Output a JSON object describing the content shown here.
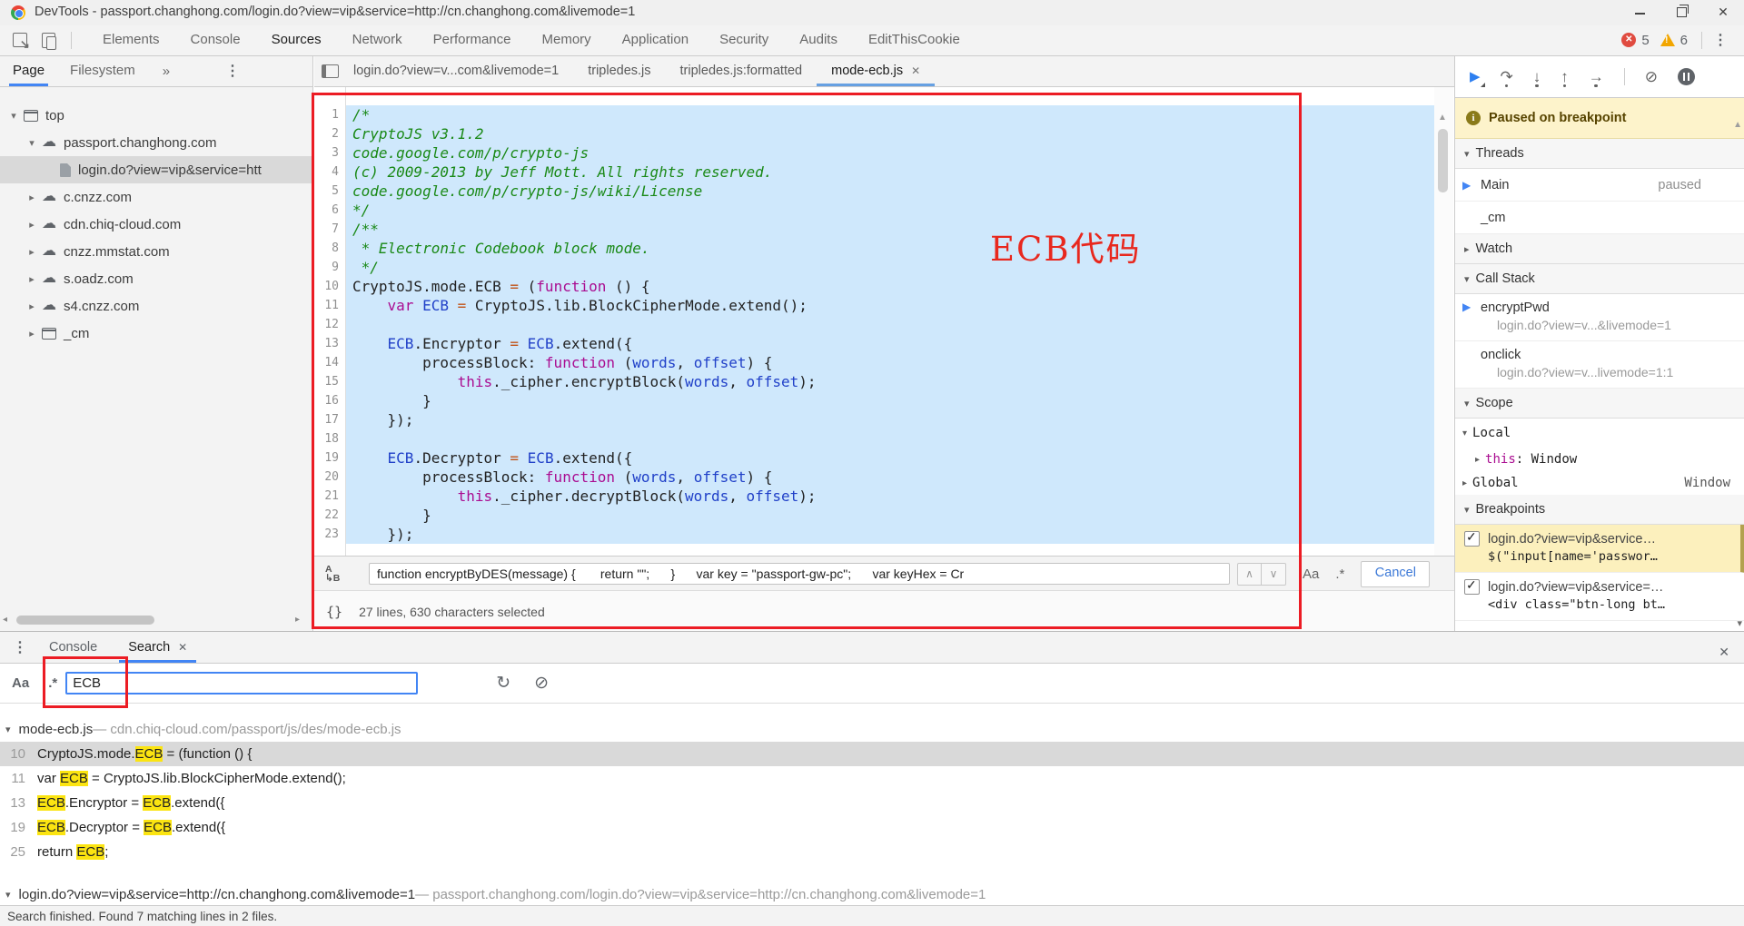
{
  "window": {
    "title": "DevTools - passport.changhong.com/login.do?view=vip&service=http://cn.changhong.com&livemode=1"
  },
  "toolbar": {
    "tabs": [
      "Elements",
      "Console",
      "Sources",
      "Network",
      "Performance",
      "Memory",
      "Application",
      "Security",
      "Audits",
      "EditThisCookie"
    ],
    "active_tab": "Sources",
    "error_count": "5",
    "warning_count": "6"
  },
  "navigator": {
    "tabs": [
      "Page",
      "Filesystem"
    ],
    "active_tab": "Page",
    "overflow_label": "»",
    "tree": [
      {
        "expander": "open",
        "icon": "frame",
        "label": "top",
        "depth": 0
      },
      {
        "expander": "open",
        "icon": "cloud",
        "label": "passport.changhong.com",
        "depth": 1
      },
      {
        "expander": "none",
        "icon": "file",
        "label": "login.do?view=vip&service=htt",
        "depth": 2,
        "selected": true
      },
      {
        "expander": "closed",
        "icon": "cloud",
        "label": "c.cnzz.com",
        "depth": 1
      },
      {
        "expander": "closed",
        "icon": "cloud",
        "label": "cdn.chiq-cloud.com",
        "depth": 1
      },
      {
        "expander": "closed",
        "icon": "cloud",
        "label": "cnzz.mmstat.com",
        "depth": 1
      },
      {
        "expander": "closed",
        "icon": "cloud",
        "label": "s.oadz.com",
        "depth": 1
      },
      {
        "expander": "closed",
        "icon": "cloud",
        "label": "s4.cnzz.com",
        "depth": 1
      },
      {
        "expander": "closed",
        "icon": "frame",
        "label": "_cm",
        "depth": 1
      }
    ]
  },
  "editor": {
    "tabs": [
      {
        "label": "login.do?view=v...com&livemode=1"
      },
      {
        "label": "tripledes.js"
      },
      {
        "label": "tripledes.js:formatted"
      },
      {
        "label": "mode-ecb.js",
        "active": true,
        "closable": true
      }
    ],
    "annotation": "ECB代码",
    "code": [
      {
        "n": "1",
        "t": [
          [
            "c",
            "/*"
          ]
        ]
      },
      {
        "n": "2",
        "t": [
          [
            "c",
            "CryptoJS v3.1.2"
          ]
        ]
      },
      {
        "n": "3",
        "t": [
          [
            "c",
            "code.google.com/p/crypto-js"
          ]
        ]
      },
      {
        "n": "4",
        "t": [
          [
            "c",
            "(c) 2009-2013 by Jeff Mott. All rights reserved."
          ]
        ]
      },
      {
        "n": "5",
        "t": [
          [
            "c",
            "code.google.com/p/crypto-js/wiki/License"
          ]
        ]
      },
      {
        "n": "6",
        "t": [
          [
            "c",
            "*/"
          ]
        ]
      },
      {
        "n": "7",
        "t": [
          [
            "c",
            "/**"
          ]
        ]
      },
      {
        "n": "8",
        "t": [
          [
            "c",
            " * Electronic Codebook block mode."
          ]
        ]
      },
      {
        "n": "9",
        "t": [
          [
            "c",
            " */"
          ]
        ]
      },
      {
        "n": "10",
        "t": [
          [
            "p",
            "CryptoJS.mode.ECB "
          ],
          [
            "o",
            "= "
          ],
          [
            "p",
            "("
          ],
          [
            "k",
            "function"
          ],
          [
            "p",
            " () {"
          ]
        ]
      },
      {
        "n": "11",
        "t": [
          [
            "p",
            "    "
          ],
          [
            "k",
            "var"
          ],
          [
            "p",
            " "
          ],
          [
            "v",
            "ECB"
          ],
          [
            "p",
            " "
          ],
          [
            "o",
            "= "
          ],
          [
            "p",
            "CryptoJS.lib.BlockCipherMode.extend();"
          ]
        ]
      },
      {
        "n": "12",
        "t": []
      },
      {
        "n": "13",
        "t": [
          [
            "p",
            "    "
          ],
          [
            "v",
            "ECB"
          ],
          [
            "p",
            ".Encryptor "
          ],
          [
            "o",
            "= "
          ],
          [
            "v",
            "ECB"
          ],
          [
            "p",
            ".extend({"
          ]
        ]
      },
      {
        "n": "14",
        "t": [
          [
            "p",
            "        processBlock: "
          ],
          [
            "k",
            "function"
          ],
          [
            "p",
            " ("
          ],
          [
            "v",
            "words"
          ],
          [
            "p",
            ", "
          ],
          [
            "v",
            "offset"
          ],
          [
            "p",
            ") {"
          ]
        ]
      },
      {
        "n": "15",
        "t": [
          [
            "p",
            "            "
          ],
          [
            "k",
            "this"
          ],
          [
            "p",
            "._cipher.encryptBlock("
          ],
          [
            "v",
            "words"
          ],
          [
            "p",
            ", "
          ],
          [
            "v",
            "offset"
          ],
          [
            "p",
            ");"
          ]
        ]
      },
      {
        "n": "16",
        "t": [
          [
            "p",
            "        }"
          ]
        ]
      },
      {
        "n": "17",
        "t": [
          [
            "p",
            "    });"
          ]
        ]
      },
      {
        "n": "18",
        "t": []
      },
      {
        "n": "19",
        "t": [
          [
            "p",
            "    "
          ],
          [
            "v",
            "ECB"
          ],
          [
            "p",
            ".Decryptor "
          ],
          [
            "o",
            "= "
          ],
          [
            "v",
            "ECB"
          ],
          [
            "p",
            ".extend({"
          ]
        ]
      },
      {
        "n": "20",
        "t": [
          [
            "p",
            "        processBlock: "
          ],
          [
            "k",
            "function"
          ],
          [
            "p",
            " ("
          ],
          [
            "v",
            "words"
          ],
          [
            "p",
            ", "
          ],
          [
            "v",
            "offset"
          ],
          [
            "p",
            ") {"
          ]
        ]
      },
      {
        "n": "21",
        "t": [
          [
            "p",
            "            "
          ],
          [
            "k",
            "this"
          ],
          [
            "p",
            "._cipher.decryptBlock("
          ],
          [
            "v",
            "words"
          ],
          [
            "p",
            ", "
          ],
          [
            "v",
            "offset"
          ],
          [
            "p",
            ");"
          ]
        ]
      },
      {
        "n": "22",
        "t": [
          [
            "p",
            "        }"
          ]
        ]
      },
      {
        "n": "23",
        "t": [
          [
            "p",
            "    });"
          ]
        ]
      }
    ],
    "find": {
      "value": "function encryptByDES(message) {       return \"\";      }      var key = \"passport-gw-pc\";      var keyHex = Cr",
      "case_label": "Aa",
      "regex_label": ".*",
      "cancel_label": "Cancel"
    },
    "status": "27 lines, 630 characters selected"
  },
  "debugger": {
    "banner": "Paused on breakpoint",
    "section_threads": "Threads",
    "section_watch": "Watch",
    "section_call_stack": "Call Stack",
    "section_scope": "Scope",
    "section_breakpoints": "Breakpoints",
    "threads": [
      {
        "name": "Main",
        "status": "paused",
        "current": true
      },
      {
        "name": "_cm",
        "status": ""
      }
    ],
    "call_stack": [
      {
        "name": "encryptPwd",
        "location": "login.do?view=v...&livemode=1",
        "current": true
      },
      {
        "name": "onclick",
        "location": "login.do?view=v...livemode=1:1"
      }
    ],
    "scope": [
      {
        "kind": "open",
        "label": "Local",
        "value": ""
      },
      {
        "kind": "prop",
        "label": "this",
        "value": "Window"
      },
      {
        "kind": "closed",
        "label": "Global",
        "value": "Window"
      }
    ],
    "breakpoints": [
      {
        "checked": true,
        "active": true,
        "title": "login.do?view=vip&service…",
        "code": "$(\"input[name='passwor…"
      },
      {
        "checked": true,
        "active": false,
        "title": "login.do?view=vip&service=…",
        "code": "<div class=\"btn-long bt…"
      }
    ]
  },
  "drawer": {
    "tabs": [
      {
        "label": "Console"
      },
      {
        "label": "Search",
        "active": true,
        "closable": true
      }
    ],
    "search": {
      "value": "ECB",
      "case_label": "Aa",
      "regex_label": ".*"
    },
    "results": [
      {
        "file": "mode-ecb.js",
        "separator": " — ",
        "path": "cdn.chiq-cloud.com/passport/js/des/mode-ecb.js",
        "matches": [
          {
            "line": "10",
            "selected": true,
            "s": [
              [
                "",
                "CryptoJS.mode."
              ],
              [
                "hl",
                "ECB"
              ],
              [
                "",
                " = (function () {"
              ]
            ]
          },
          {
            "line": "11",
            "s": [
              [
                "",
                "var "
              ],
              [
                "hl",
                "ECB"
              ],
              [
                "",
                " = CryptoJS.lib.BlockCipherMode.extend();"
              ]
            ]
          },
          {
            "line": "13",
            "s": [
              [
                "hl",
                "ECB"
              ],
              [
                "",
                ".Encryptor = "
              ],
              [
                "hl",
                "ECB"
              ],
              [
                "",
                ".extend({"
              ]
            ]
          },
          {
            "line": "19",
            "s": [
              [
                "hl",
                "ECB"
              ],
              [
                "",
                ".Decryptor = "
              ],
              [
                "hl",
                "ECB"
              ],
              [
                "",
                ".extend({"
              ]
            ]
          },
          {
            "line": "25",
            "s": [
              [
                "",
                "return "
              ],
              [
                "hl",
                "ECB"
              ],
              [
                "",
                ";"
              ]
            ]
          }
        ]
      },
      {
        "file": "login.do?view=vip&service=http://cn.changhong.com&livemode=1",
        "separator": " — ",
        "path": "passport.changhong.com/login.do?view=vip&service=http://cn.changhong.com&livemode=1",
        "matches": []
      }
    ],
    "status": "Search finished. Found 7 matching lines in 2 files."
  },
  "icons": {
    "close": "✕",
    "kebab": "⋮",
    "search_mode": "A\n↳B",
    "prev": "∧",
    "next": "∨",
    "refresh": "↻",
    "clear": "⊘",
    "braces": "{}",
    "resume": "▶",
    "step_over": "↷",
    "step_into": "↓",
    "step_out": "↑",
    "step": "→",
    "deactivate": "⊘",
    "info": "i",
    "arrow_open": "▾",
    "arrow_closed": "▸",
    "scroll_up": "▲",
    "scroll_down": "▾",
    "scroll_left": "◂",
    "scroll_right": "▸",
    "current_mark": "▶"
  }
}
